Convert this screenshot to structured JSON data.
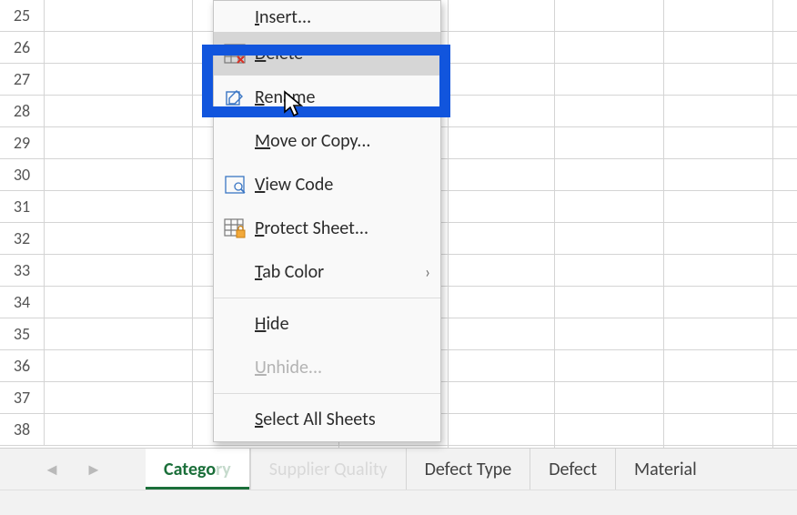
{
  "row_headers": [
    25,
    26,
    27,
    28,
    29,
    30,
    31,
    32,
    33,
    34,
    35,
    36,
    37,
    38
  ],
  "context_menu": {
    "insert": "Insert...",
    "delete": "Delete",
    "rename": "Rename",
    "move_copy": "Move or Copy...",
    "view_code": "View Code",
    "protect_sheet": "Protect Sheet...",
    "tab_color": "Tab Color",
    "hide": "Hide",
    "unhide": "Unhide...",
    "select_all": "Select All Sheets"
  },
  "tabs": {
    "active": "Category",
    "supplier_quality": "Supplier  Quality",
    "defect_type": "Defect Type",
    "defect": "Defect",
    "material": "Material"
  }
}
